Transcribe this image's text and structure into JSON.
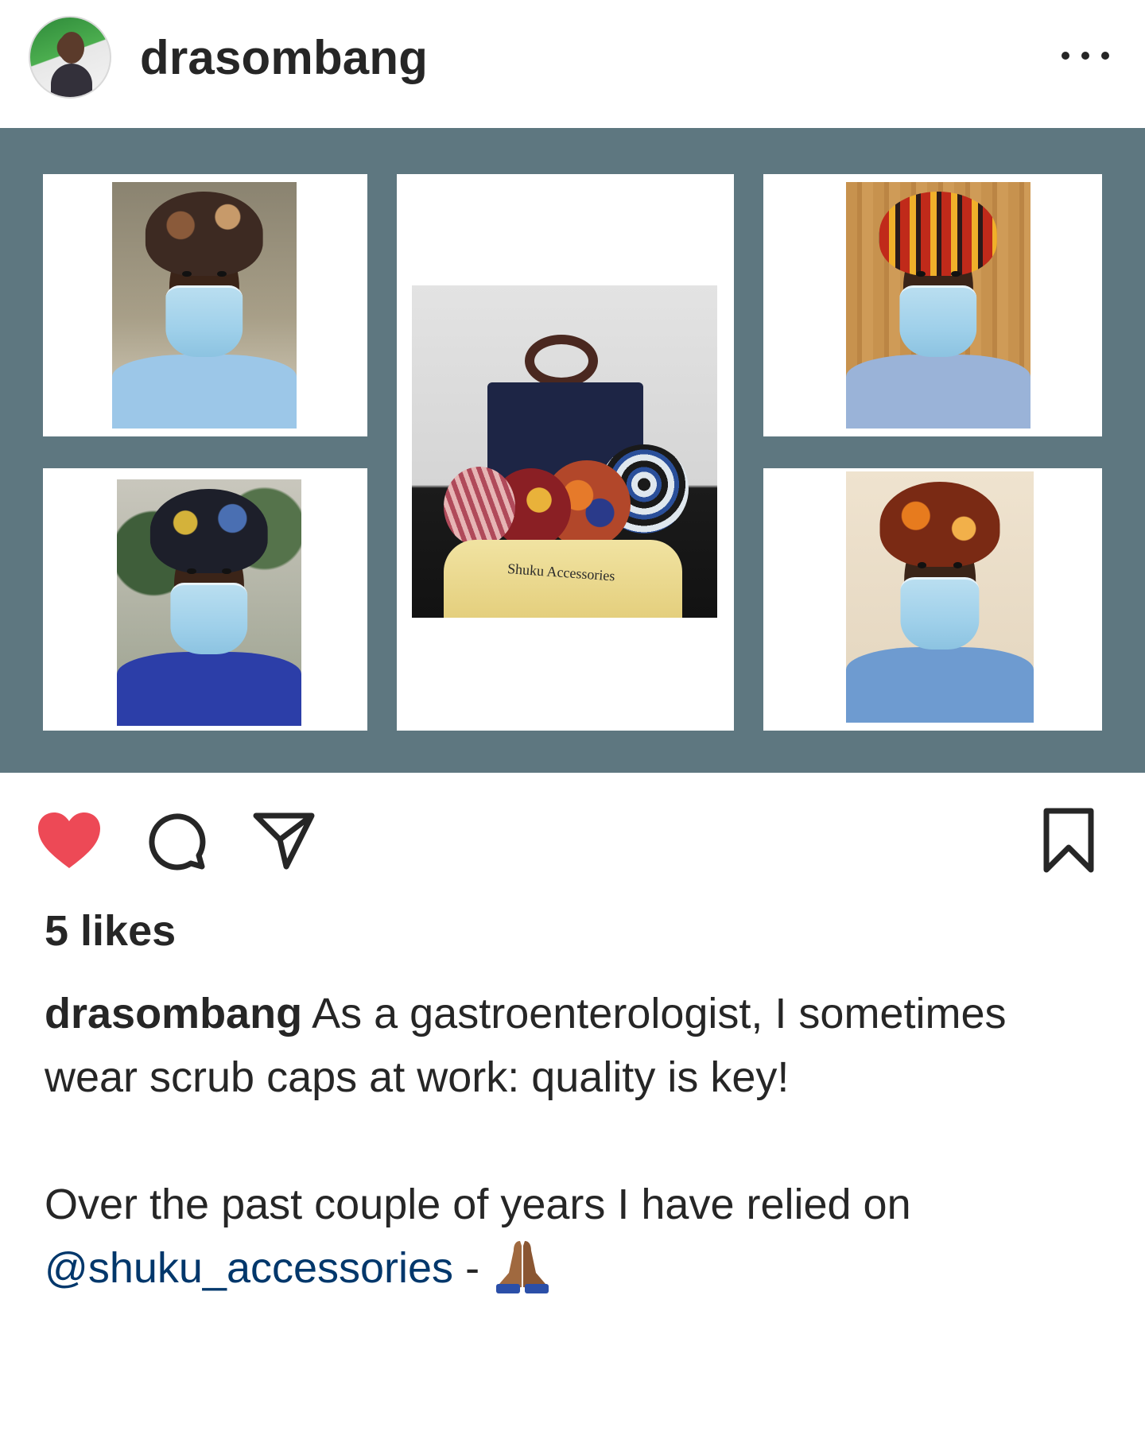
{
  "header": {
    "username": "drasombang",
    "more_icon": "more-horizontal-icon"
  },
  "post": {
    "image_alt_tags": [
      "scrub-cap-photo",
      "scrub-cap-photo",
      "shuku-bag-photo",
      "scrub-cap-photo",
      "scrub-cap-photo"
    ],
    "bag_brand_text": "Shuku Accessories"
  },
  "actions": {
    "like_icon": "heart-filled-icon",
    "comment_icon": "comment-icon",
    "share_icon": "paper-plane-icon",
    "save_icon": "bookmark-icon",
    "like_color": "#ed4956"
  },
  "likes": {
    "label": "5 likes"
  },
  "caption": {
    "username": "drasombang",
    "text_line1": "As a gastroenterologist, I sometimes wear scrub caps at work: quality is key!",
    "text_line2": "Over the past couple of years I have relied on",
    "mention": "@shuku_accessories",
    "trailing": " - ",
    "emoji": "folded-hands-emoji"
  }
}
